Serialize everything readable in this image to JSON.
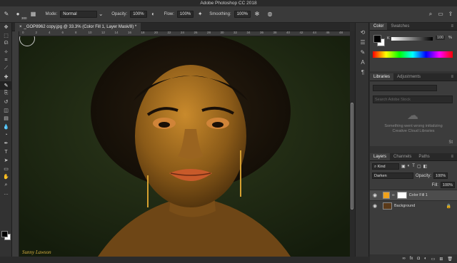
{
  "app": {
    "title": "Adobe Photoshop CC 2018"
  },
  "options": {
    "brush_size": "300",
    "mode_label": "Mode:",
    "mode_value": "Normal",
    "opacity_label": "Opacity:",
    "opacity_value": "100%",
    "flow_label": "Flow:",
    "flow_value": "100%",
    "smoothing_label": "Smoothing:",
    "smoothing_value": "100%"
  },
  "document": {
    "tab_title": "_GOP8962 copy.jpg @ 33.3% (Color Fill 1, Layer Mask/8) *"
  },
  "ruler": {
    "top_labels": [
      "0",
      "2",
      "4",
      "6",
      "8",
      "10",
      "12",
      "14",
      "16",
      "18",
      "20",
      "22",
      "24",
      "26",
      "28",
      "30",
      "32",
      "34",
      "36",
      "38",
      "40",
      "42",
      "44",
      "46",
      "48"
    ]
  },
  "canvas": {
    "watermark": "Sunny Lawson"
  },
  "tools": [
    "move",
    "marquee",
    "lasso",
    "quick-select",
    "crop",
    "eyedropper",
    "heal",
    "brush",
    "clone",
    "history-brush",
    "eraser",
    "gradient",
    "blur",
    "dodge",
    "pen",
    "type",
    "path-select",
    "shape",
    "hand",
    "zoom",
    "more"
  ],
  "color_panel": {
    "tabs": [
      "Color",
      "Swatches"
    ],
    "slider_label": "K",
    "slider_value": "100",
    "foreground": "#000000",
    "background": "#ffffff"
  },
  "libraries_panel": {
    "tabs": [
      "Libraries",
      "Adjustments"
    ],
    "search_placeholder": "Search Adobe Stock",
    "error_line1": "Something went wrong initializing",
    "error_line2": "Creative Cloud Libraries"
  },
  "layers_panel": {
    "tabs": [
      "Layers",
      "Channels",
      "Paths"
    ],
    "kind_label": "Kind",
    "blend_mode": "Darken",
    "opacity_label": "Opacity:",
    "opacity_value": "100%",
    "fill_label": "Fill:",
    "fill_value": "100%",
    "layers": [
      {
        "name": "Color Fill 1",
        "fill": "#f0a21c",
        "selected": true
      },
      {
        "name": "Background",
        "fill": "#5a3a1a",
        "selected": false
      }
    ]
  },
  "colors": {
    "fill_swatch": "#f0a21c",
    "canvas_bg": "#1f2a14"
  }
}
